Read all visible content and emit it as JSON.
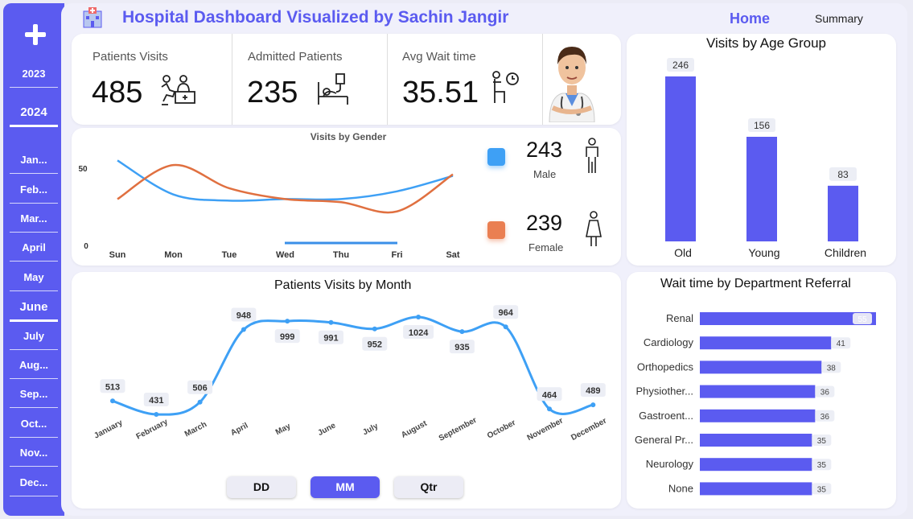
{
  "header": {
    "title": "Hospital Dashboard Visualized by Sachin Jangir",
    "nav_home": "Home",
    "nav_summary": "Summary"
  },
  "sidebar": {
    "years": [
      "2023",
      "2024"
    ],
    "active_year": "2024",
    "months": [
      "Jan...",
      "Feb...",
      "Mar...",
      "April",
      "May",
      "June",
      "July",
      "Aug...",
      "Sep...",
      "Oct...",
      "Nov...",
      "Dec..."
    ],
    "active_month": "June"
  },
  "kpis": {
    "patients_visits": {
      "label": "Patients Visits",
      "value": "485"
    },
    "admitted_patients": {
      "label": "Admitted Patients",
      "value": "235"
    },
    "avg_wait_time": {
      "label": "Avg Wait time",
      "value": "35.51"
    }
  },
  "gender": {
    "male": {
      "count": "243",
      "label": "Male",
      "color": "#3ea0f5"
    },
    "female": {
      "count": "239",
      "label": "Female",
      "color": "#ea7f52"
    }
  },
  "colors": {
    "accent": "#5b5bf0",
    "line_blue": "#3ea0f5",
    "line_orange": "#e07040"
  },
  "toggle": {
    "dd": "DD",
    "mm": "MM",
    "qtr": "Qtr",
    "active": "MM"
  },
  "chart_data": [
    {
      "type": "line",
      "title": "Visits by Gender",
      "categories": [
        "Sun",
        "Mon",
        "Tue",
        "Wed",
        "Thu",
        "Fri",
        "Sat"
      ],
      "y_ticks": [
        "0",
        "50"
      ],
      "series": [
        {
          "name": "Male",
          "color": "#3ea0f5",
          "values": [
            55,
            33,
            29,
            30,
            30,
            35,
            45
          ]
        },
        {
          "name": "Female",
          "color": "#e07040",
          "values": [
            30,
            52,
            37,
            30,
            28,
            22,
            46
          ]
        }
      ]
    },
    {
      "type": "bar",
      "title": "Visits by Age Group",
      "categories": [
        "Old",
        "Young",
        "Children"
      ],
      "values": [
        246,
        156,
        83
      ],
      "ylim": [
        0,
        260
      ]
    },
    {
      "type": "line",
      "title": "Patients Visits by Month",
      "categories": [
        "January",
        "February",
        "March",
        "April",
        "May",
        "June",
        "July",
        "August",
        "September",
        "October",
        "November",
        "December"
      ],
      "values": [
        513,
        431,
        506,
        948,
        999,
        991,
        952,
        1024,
        935,
        964,
        464,
        489
      ],
      "ylim": [
        400,
        1050
      ]
    },
    {
      "type": "bar",
      "orientation": "horizontal",
      "title": "Wait time by Department Referral",
      "categories": [
        "Renal",
        "Cardiology",
        "Orthopedics",
        "Physiother...",
        "Gastroent...",
        "General Pr...",
        "Neurology",
        "None"
      ],
      "values": [
        55,
        41,
        38,
        36,
        36,
        35,
        35,
        35
      ],
      "xlim": [
        0,
        55
      ]
    }
  ]
}
